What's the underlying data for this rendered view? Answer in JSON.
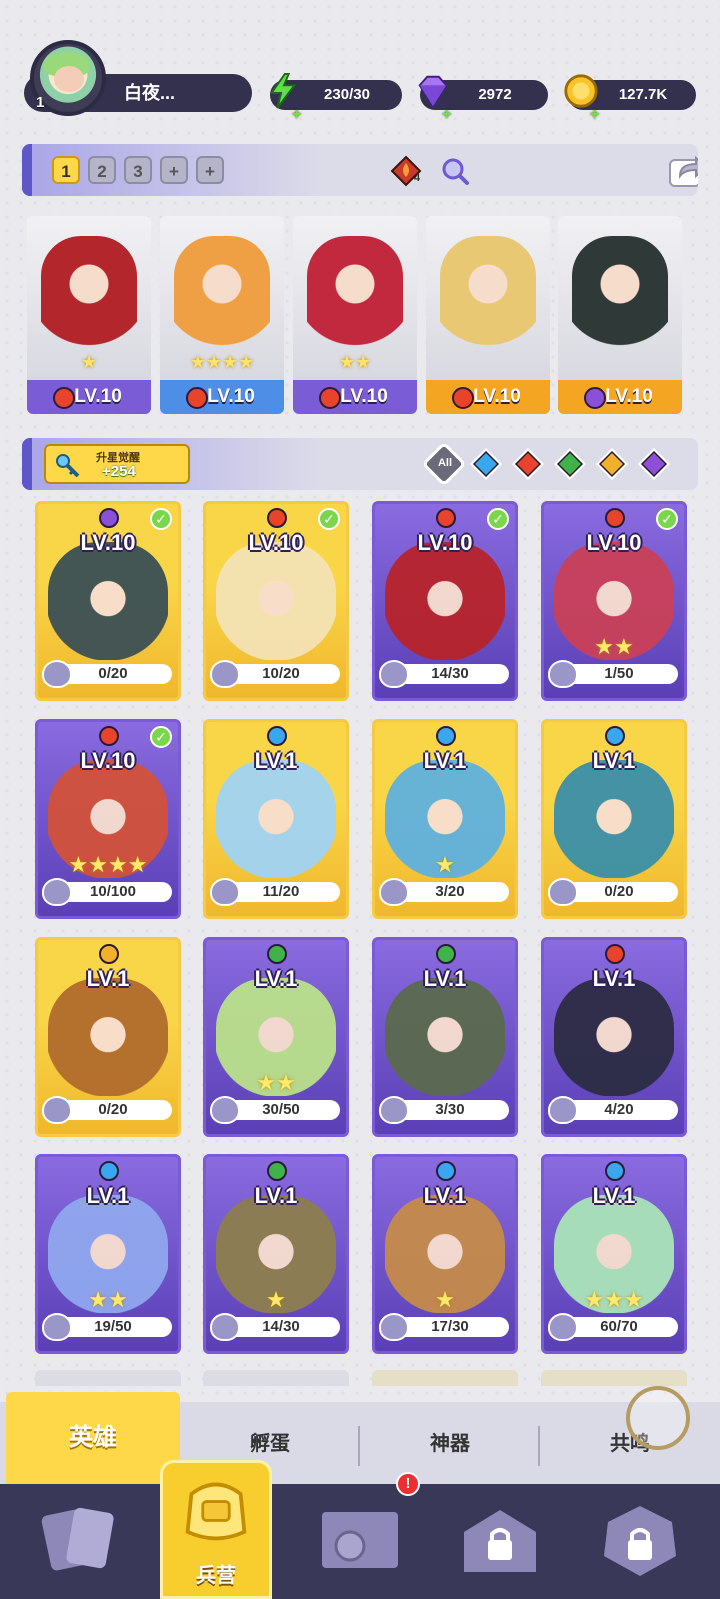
{
  "player": {
    "name": "白夜...",
    "level": "1"
  },
  "resources": {
    "energy": "230/30",
    "gems": "2972",
    "coins": "127.7K"
  },
  "team": {
    "tabs": [
      "1",
      "2",
      "3",
      "+",
      "+"
    ],
    "active_tab": "1",
    "gem_badge_count": "4"
  },
  "team_heroes": [
    {
      "level": "LV.10",
      "stars": "★",
      "element": "fire",
      "foot": "purple",
      "art_color": "#b2262c"
    },
    {
      "level": "LV.10",
      "stars": "★★★★",
      "element": "fire",
      "foot": "blue",
      "art_color": "#f0a044"
    },
    {
      "level": "LV.10",
      "stars": "★★",
      "element": "fire",
      "foot": "purple",
      "art_color": "#c2283e"
    },
    {
      "level": "LV.10",
      "stars": "",
      "element": "fire",
      "foot": "gold",
      "art_color": "#e8c873"
    },
    {
      "level": "LV.10",
      "stars": "",
      "element": "dark",
      "foot": "gold",
      "art_color": "#2f3a38"
    }
  ],
  "filters": {
    "awaken_title": "升星觉醒",
    "awaken_count": "+254",
    "all_label": "All",
    "elements": [
      "water",
      "fire",
      "wind",
      "light",
      "dark"
    ]
  },
  "heroes": [
    {
      "level": "LV.10",
      "progress": "0/20",
      "rarity": "gold",
      "element": "dark",
      "check": true,
      "stars": "",
      "art": "#3b4f55"
    },
    {
      "level": "LV.10",
      "progress": "10/20",
      "rarity": "gold",
      "element": "fire",
      "check": true,
      "stars": "",
      "art": "#f3e2b4"
    },
    {
      "level": "LV.10",
      "progress": "14/30",
      "rarity": "purple",
      "element": "fire",
      "check": true,
      "stars": "",
      "art": "#b8232b"
    },
    {
      "level": "LV.10",
      "progress": "1/50",
      "rarity": "purple",
      "element": "fire",
      "check": true,
      "stars": "★★",
      "art": "#c94059"
    },
    {
      "level": "LV.10",
      "progress": "10/100",
      "rarity": "purple",
      "element": "fire",
      "check": true,
      "stars": "★★★★",
      "art": "#d2513a"
    },
    {
      "level": "LV.1",
      "progress": "11/20",
      "rarity": "gold",
      "element": "water",
      "check": false,
      "stars": "",
      "art": "#9fd3f3"
    },
    {
      "level": "LV.1",
      "progress": "3/20",
      "rarity": "gold",
      "element": "water",
      "check": false,
      "stars": "★",
      "art": "#5fb1de"
    },
    {
      "level": "LV.1",
      "progress": "0/20",
      "rarity": "gold",
      "element": "water",
      "check": false,
      "stars": "",
      "art": "#3a8fa8"
    },
    {
      "level": "LV.1",
      "progress": "0/20",
      "rarity": "gold",
      "element": "light",
      "check": false,
      "stars": "",
      "art": "#b06c2c"
    },
    {
      "level": "LV.1",
      "progress": "30/50",
      "rarity": "purple",
      "element": "wind",
      "check": false,
      "stars": "★★",
      "art": "#b9e08a"
    },
    {
      "level": "LV.1",
      "progress": "3/30",
      "rarity": "purple",
      "element": "wind",
      "check": false,
      "stars": "",
      "art": "#5a6a4e"
    },
    {
      "level": "LV.1",
      "progress": "4/20",
      "rarity": "purple",
      "element": "fire",
      "check": false,
      "stars": "",
      "art": "#2c2c44"
    },
    {
      "level": "LV.1",
      "progress": "19/50",
      "rarity": "purple",
      "element": "water",
      "check": false,
      "stars": "★★",
      "art": "#8fa7ee"
    },
    {
      "level": "LV.1",
      "progress": "14/30",
      "rarity": "purple",
      "element": "wind",
      "check": false,
      "stars": "★",
      "art": "#8d7e4e"
    },
    {
      "level": "LV.1",
      "progress": "17/30",
      "rarity": "purple",
      "element": "water",
      "check": false,
      "stars": "★",
      "art": "#c58a4a"
    },
    {
      "level": "LV.1",
      "progress": "60/70",
      "rarity": "purple",
      "element": "water",
      "check": false,
      "stars": "★★★",
      "art": "#a9e3b8"
    }
  ],
  "subtabs": {
    "heroes": "英雄",
    "hatch": "孵蛋",
    "artifact": "神器",
    "resonance": "共鸣"
  },
  "nav": {
    "barracks_label": "兵营",
    "alert": "!"
  },
  "colors": {
    "fire": "#e8432b",
    "water": "#3aa6ee",
    "wind": "#3fb34a",
    "light": "#f2b12c",
    "dark": "#8b4fd8"
  }
}
